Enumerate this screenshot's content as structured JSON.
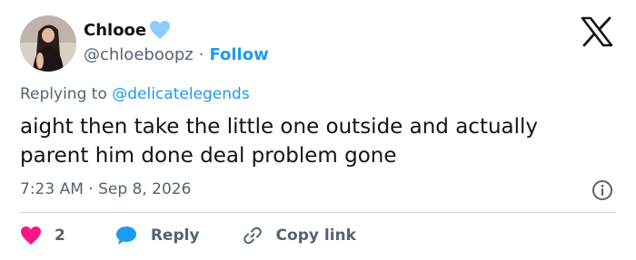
{
  "author": {
    "display_name": "Chlooe",
    "handle": "@chloeboopz",
    "separator": "·",
    "follow_label": "Follow",
    "badge_icon": "light-blue-heart-icon",
    "badge_color": "#8ecdf7"
  },
  "reply": {
    "prefix": "Replying to",
    "mention": "@delicatelegends"
  },
  "tweet": {
    "text": "aight then take the little one outside and actually parent him done deal problem gone",
    "timestamp": "7:23 AM · Sep 8, 2026"
  },
  "actions": {
    "like_count": "2",
    "reply_label": "Reply",
    "copy_label": "Copy link"
  },
  "colors": {
    "accent": "#1d9bf0",
    "like": "#f91880",
    "muted": "#536471",
    "text": "#0f1419",
    "divider": "#cfd9de"
  },
  "icons": {
    "logo": "x-logo-icon",
    "info": "info-icon",
    "like": "heart-icon",
    "reply": "speech-bubble-icon",
    "copy": "link-icon"
  }
}
